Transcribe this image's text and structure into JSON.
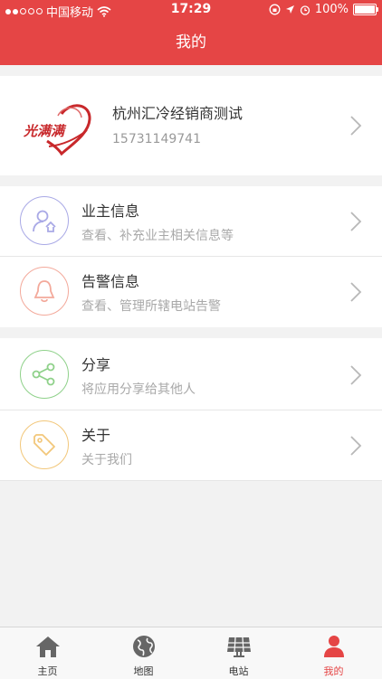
{
  "status": {
    "carrier": "中国移动",
    "time": "17:29",
    "battery": "100%",
    "battery_level": 1.0
  },
  "nav": {
    "title": "我的"
  },
  "profile": {
    "name": "杭州汇冷经销商测试",
    "phone": "15731149741",
    "logo_text": "光满满"
  },
  "menu": [
    {
      "title": "业主信息",
      "subtitle": "查看、补充业主相关信息等",
      "icon": "owner-icon",
      "color": "#a9a9e6"
    },
    {
      "title": "告警信息",
      "subtitle": "查看、管理所辖电站告警",
      "icon": "bell-icon",
      "color": "#f3a99b"
    },
    {
      "title": "分享",
      "subtitle": "将应用分享给其他人",
      "icon": "share-icon",
      "color": "#8fd18a"
    },
    {
      "title": "关于",
      "subtitle": "关于我们",
      "icon": "tag-icon",
      "color": "#f2c77a"
    }
  ],
  "tabs": [
    {
      "label": "主页",
      "icon": "home-icon"
    },
    {
      "label": "地图",
      "icon": "globe-icon"
    },
    {
      "label": "电站",
      "icon": "solar-panel-icon"
    },
    {
      "label": "我的",
      "icon": "person-icon",
      "active": true
    }
  ],
  "colors": {
    "accent": "#e54545",
    "inactive_icon": "#666666"
  }
}
